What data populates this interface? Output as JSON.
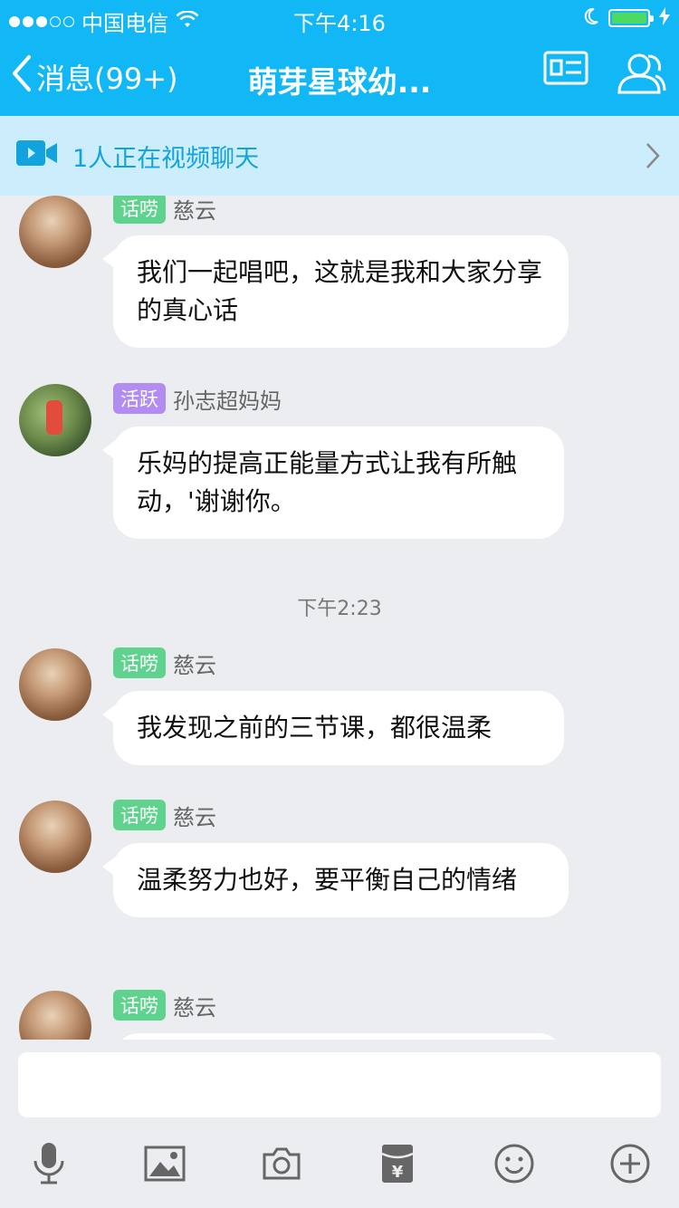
{
  "status_bar": {
    "carrier": "中国电信",
    "time": "下午4:16",
    "signal_dots_filled": 3,
    "signal_dots_total": 5,
    "battery_level": 1.0
  },
  "nav": {
    "back_label": "消息(99+)",
    "title": "萌芽星球幼...",
    "icons": [
      "profile-card-icon",
      "group-members-icon"
    ]
  },
  "banner": {
    "text": "1人正在视频聊天",
    "icon": "video-camera-icon"
  },
  "messages": [
    {
      "badge": "话唠",
      "badge_color": "#5fd38d",
      "name": "慈云",
      "text": "我们一起唱吧，这就是我和大家分享的真心话"
    },
    {
      "badge": "活跃",
      "badge_color": "#b28cf0",
      "name": "孙志超妈妈",
      "text": "乐妈的提高正能量方式让我有所触动，'谢谢你。"
    },
    {
      "timestamp": "下午2:23"
    },
    {
      "badge": "话唠",
      "badge_color": "#5fd38d",
      "name": "慈云",
      "text": "我发现之前的三节课，都很温柔"
    },
    {
      "badge": "话唠",
      "badge_color": "#5fd38d",
      "name": "慈云",
      "text": "温柔努力也好，要平衡自己的情绪"
    },
    {
      "badge": "话唠",
      "badge_color": "#5fd38d",
      "name": "慈云",
      "text": ""
    }
  ],
  "input": {
    "value": ""
  },
  "toolbar": [
    "microphone-icon",
    "image-icon",
    "camera-icon",
    "red-packet-icon",
    "emoji-icon",
    "plus-icon"
  ],
  "colors": {
    "header": "#12b7f5",
    "banner_bg": "#cceefc",
    "chat_bg": "#ebedf0",
    "battery_fill": "#4cd964"
  }
}
